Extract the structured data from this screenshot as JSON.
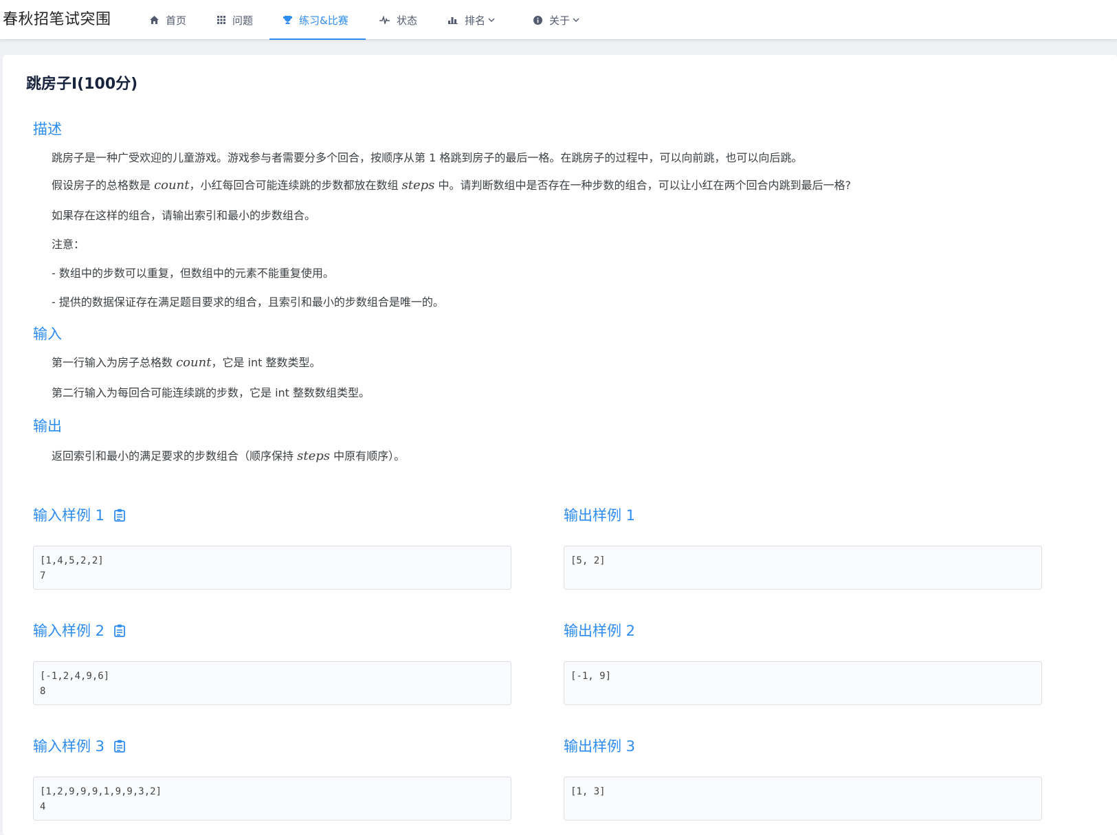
{
  "header": {
    "brand": "春秋招笔试突围",
    "nav": [
      {
        "label": "首页",
        "icon": "home-icon"
      },
      {
        "label": "问题",
        "icon": "grid-icon"
      },
      {
        "label": "练习&比赛",
        "icon": "trophy-icon",
        "active": true
      },
      {
        "label": "状态",
        "icon": "pulse-icon"
      },
      {
        "label": "排名",
        "icon": "bar-chart-icon",
        "dropdown": true
      },
      {
        "label": "关于",
        "icon": "info-icon",
        "dropdown": true
      }
    ],
    "accent_color": "#2d8cf0"
  },
  "problem": {
    "title": "跳房子I(100分)",
    "description": {
      "heading": "描述",
      "p1": "跳房子是一种广受欢迎的儿童游戏。游戏参与者需要分多个回合，按顺序从第 1 格跳到房子的最后一格。在跳房子的过程中，可以向前跳，也可以向后跳。",
      "p2_a": "假设房子的总格数是 ",
      "p2_var1": "count",
      "p2_b": "，小红每回合可能连续跳的步数都放在数组 ",
      "p2_var2": "steps",
      "p2_c": " 中。请判断数组中是否存在一种步数的组合，可以让小红在两个回合内跳到最后一格?",
      "p3": "如果存在这样的组合，请输出索引和最小的步数组合。",
      "p4": "注意：",
      "p5": "- 数组中的步数可以重复，但数组中的元素不能重复使用。",
      "p6": "- 提供的数据保证存在满足题目要求的组合，且索引和最小的步数组合是唯一的。"
    },
    "input": {
      "heading": "输入",
      "p1_a": "第一行输入为房子总格数 ",
      "p1_var": "count",
      "p1_b": "，它是 int 整数类型。",
      "p2": "第二行输入为每回合可能连续跳的步数，它是 int 整数数组类型。"
    },
    "output": {
      "heading": "输出",
      "p1_a": "返回索引和最小的满足要求的步数组合（顺序保持 ",
      "p1_var": "steps",
      "p1_b": " 中原有顺序）。"
    },
    "samples": [
      {
        "in_title": "输入样例 1",
        "out_title": "输出样例 1",
        "input": "[1,4,5,2,2]\n7",
        "output": "[5, 2]"
      },
      {
        "in_title": "输入样例 2",
        "out_title": "输出样例 2",
        "input": "[-1,2,4,9,6]\n8",
        "output": "[-1, 9]"
      },
      {
        "in_title": "输入样例 3",
        "out_title": "输出样例 3",
        "input": "[1,2,9,9,9,1,9,9,3,2]\n4",
        "output": "[1, 3]"
      }
    ]
  }
}
